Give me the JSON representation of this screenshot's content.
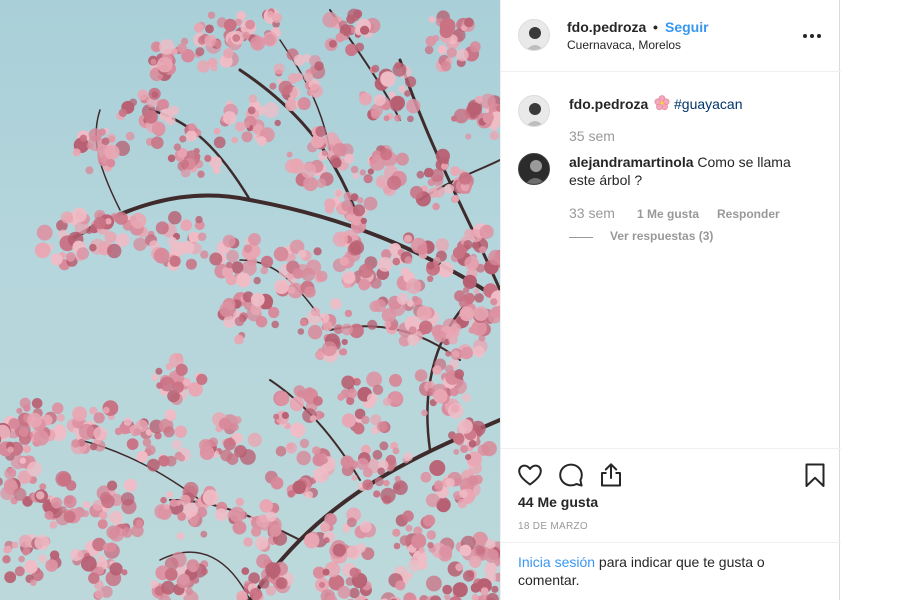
{
  "header": {
    "username": "fdo.pedroza",
    "separator": "•",
    "follow_label": "Seguir",
    "location": "Cuernavaca, Morelos",
    "more_icon": "ellipsis-horizontal"
  },
  "caption": {
    "username": "fdo.pedroza",
    "emoji": "cherry-blossom",
    "hashtag": "#guayacan",
    "time": "35 sem"
  },
  "comments": [
    {
      "username": "alejandramartinola",
      "text": "Como se llama este árbol ?",
      "time": "33 sem",
      "likes": "1 Me gusta",
      "reply_label": "Responder",
      "view_replies": "Ver respuestas (3)"
    }
  ],
  "actions": {
    "icons": [
      "heart-icon",
      "comment-icon",
      "share-icon",
      "bookmark-icon"
    ],
    "likes_count": "44 Me gusta",
    "date": "18 DE MARZO"
  },
  "login_prompt": {
    "link": "Inicia sesión",
    "text": " para indicar que te gusta o comentar."
  },
  "colors": {
    "link_blue": "#3897f0",
    "hashtag_blue": "#003569",
    "muted_gray": "#999999",
    "text": "#262626",
    "sky": "#b5d6dc",
    "blossom": "#d8899a"
  }
}
